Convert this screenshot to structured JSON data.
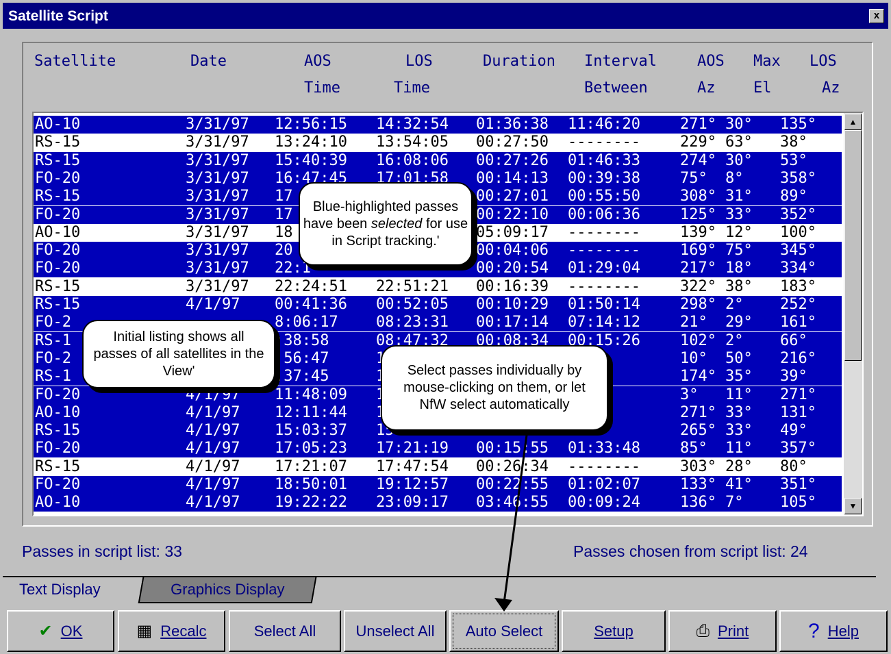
{
  "window": {
    "title": "Satellite Script",
    "close_label": "x"
  },
  "headers": {
    "satellite": "Satellite",
    "date": "Date",
    "aos_time_1": "AOS",
    "aos_time_2": "Time",
    "los_time_1": "LOS",
    "los_time_2": "Time",
    "duration": "Duration",
    "interval_1": "Interval",
    "interval_2": "Between",
    "aos_az_1": "AOS",
    "aos_az_2": "Az",
    "max_el_1": "Max",
    "max_el_2": "El",
    "los_az_1": "LOS",
    "los_az_2": "Az"
  },
  "passes": [
    {
      "sat": "AO-10",
      "date": "3/31/97",
      "aos": "12:56:15",
      "los": "14:32:54",
      "dur": "01:36:38",
      "int": "11:46:20",
      "aosaz": "271°",
      "maxel": "30°",
      "losaz": "135°",
      "selected": true
    },
    {
      "sat": "RS-15",
      "date": "3/31/97",
      "aos": "13:24:10",
      "los": "13:54:05",
      "dur": "00:27:50",
      "int": "--------",
      "aosaz": "229°",
      "maxel": "63°",
      "losaz": "38°",
      "selected": false
    },
    {
      "sat": "RS-15",
      "date": "3/31/97",
      "aos": "15:40:39",
      "los": "16:08:06",
      "dur": "00:27:26",
      "int": "01:46:33",
      "aosaz": "274°",
      "maxel": "30°",
      "losaz": "53°",
      "selected": true
    },
    {
      "sat": "FO-20",
      "date": "3/31/97",
      "aos": "16:47:45",
      "los": "17:01:58",
      "dur": "00:14:13",
      "int": "00:39:38",
      "aosaz": "75°",
      "maxel": "8°",
      "losaz": "358°",
      "selected": true
    },
    {
      "sat": "RS-15",
      "date": "3/31/97",
      "aos": "17",
      "los": "",
      "dur": "00:27:01",
      "int": "00:55:50",
      "aosaz": "308°",
      "maxel": "31°",
      "losaz": "89°",
      "selected": true
    },
    {
      "sat": "FO-20",
      "date": "3/31/97",
      "aos": "17",
      "los": "",
      "dur": "00:22:10",
      "int": "00:06:36",
      "aosaz": "125°",
      "maxel": "33°",
      "losaz": "352°",
      "selected": true
    },
    {
      "sat": "AO-10",
      "date": "3/31/97",
      "aos": "18",
      "los": "",
      "dur": "05:09:17",
      "int": "--------",
      "aosaz": "139°",
      "maxel": "12°",
      "losaz": "100°",
      "selected": false
    },
    {
      "sat": "FO-20",
      "date": "3/31/97",
      "aos": "20",
      "los": "",
      "dur": "00:04:06",
      "int": "--------",
      "aosaz": "169°",
      "maxel": "75°",
      "losaz": "345°",
      "selected": true
    },
    {
      "sat": "FO-20",
      "date": "3/31/97",
      "aos": "22:1",
      "los": "",
      "dur": "00:20:54",
      "int": "01:29:04",
      "aosaz": "217°",
      "maxel": "18°",
      "losaz": "334°",
      "selected": true
    },
    {
      "sat": "RS-15",
      "date": "3/31/97",
      "aos": "22:24:51",
      "los": "22:51:21",
      "dur": "00:16:39",
      "int": "--------",
      "aosaz": "322°",
      "maxel": "38°",
      "losaz": "183°",
      "selected": false
    },
    {
      "sat": "RS-15",
      "date": "4/1/97",
      "aos": "00:41:36",
      "los": "00:52:05",
      "dur": "00:10:29",
      "int": "01:50:14",
      "aosaz": "298°",
      "maxel": "2°",
      "losaz": "252°",
      "selected": true
    },
    {
      "sat": "FO-2",
      "date": "",
      "aos": "8:06:17",
      "los": "08:23:31",
      "dur": "00:17:14",
      "int": "07:14:12",
      "aosaz": "21°",
      "maxel": "29°",
      "losaz": "161°",
      "selected": true
    },
    {
      "sat": "RS-1",
      "date": "",
      "aos": ":38:58",
      "los": "08:47:32",
      "dur": "00:08:34",
      "int": "00:15:26",
      "aosaz": "102°",
      "maxel": "2°",
      "losaz": "66°",
      "selected": true
    },
    {
      "sat": "FO-2",
      "date": "",
      "aos": ":56:47",
      "los": "10",
      "dur": "",
      "int": ":15",
      "aosaz": "10°",
      "maxel": "50°",
      "losaz": "216°",
      "selected": true
    },
    {
      "sat": "RS-1",
      "date": "",
      "aos": ":37:45",
      "los": "11",
      "dur": "",
      "int": ":44",
      "aosaz": "174°",
      "maxel": "35°",
      "losaz": "39°",
      "selected": true
    },
    {
      "sat": "FO-20",
      "date": "4/1/97",
      "aos": "11:48:09",
      "los": "12",
      "dur": "",
      "int": ":56",
      "aosaz": "3°",
      "maxel": "11°",
      "losaz": "271°",
      "selected": true
    },
    {
      "sat": "AO-10",
      "date": "4/1/97",
      "aos": "12:11:44",
      "los": "13",
      "dur": "",
      "int": ":54",
      "aosaz": "271°",
      "maxel": "33°",
      "losaz": "131°",
      "selected": true
    },
    {
      "sat": "RS-15",
      "date": "4/1/97",
      "aos": "15:03:37",
      "los": "15",
      "dur": "",
      "int": ":37",
      "aosaz": "265°",
      "maxel": "33°",
      "losaz": "49°",
      "selected": true
    },
    {
      "sat": "FO-20",
      "date": "4/1/97",
      "aos": "17:05:23",
      "los": "17:21:19",
      "dur": "00:15:55",
      "int": "01:33:48",
      "aosaz": "85°",
      "maxel": "11°",
      "losaz": "357°",
      "selected": true
    },
    {
      "sat": "RS-15",
      "date": "4/1/97",
      "aos": "17:21:07",
      "los": "17:47:54",
      "dur": "00:26:34",
      "int": "--------",
      "aosaz": "303°",
      "maxel": "28°",
      "losaz": "80°",
      "selected": false
    },
    {
      "sat": "FO-20",
      "date": "4/1/97",
      "aos": "18:50:01",
      "los": "19:12:57",
      "dur": "00:22:55",
      "int": "01:02:07",
      "aosaz": "133°",
      "maxel": "41°",
      "losaz": "351°",
      "selected": true
    },
    {
      "sat": "AO-10",
      "date": "4/1/97",
      "aos": "19:22:22",
      "los": "23:09:17",
      "dur": "03:46:55",
      "int": "00:09:24",
      "aosaz": "136°",
      "maxel": "7°",
      "losaz": "105°",
      "selected": true
    }
  ],
  "status": {
    "left": "Passes in script list: 33",
    "right": "Passes chosen from script list: 24"
  },
  "tabs": {
    "text": "Text Display",
    "graphics": "Graphics Display"
  },
  "buttons": {
    "ok": "OK",
    "recalc": "Recalc",
    "select_all": "Select All",
    "unselect_all": "Unselect All",
    "auto_select": "Auto Select",
    "setup": "Setup",
    "print": "Print",
    "help": "Help"
  },
  "callouts": {
    "blue_1": "Blue-highlighted passes have been",
    "blue_em": "selected",
    "blue_2": "for use in Script tracking.'",
    "initial": "Initial listing shows all passes of all satellites in the View'",
    "select": "Select passes individually by mouse-clicking on them, or let NfW select automatically"
  },
  "colors": {
    "selected_row": "#0000b8",
    "title_bar": "#000080"
  }
}
